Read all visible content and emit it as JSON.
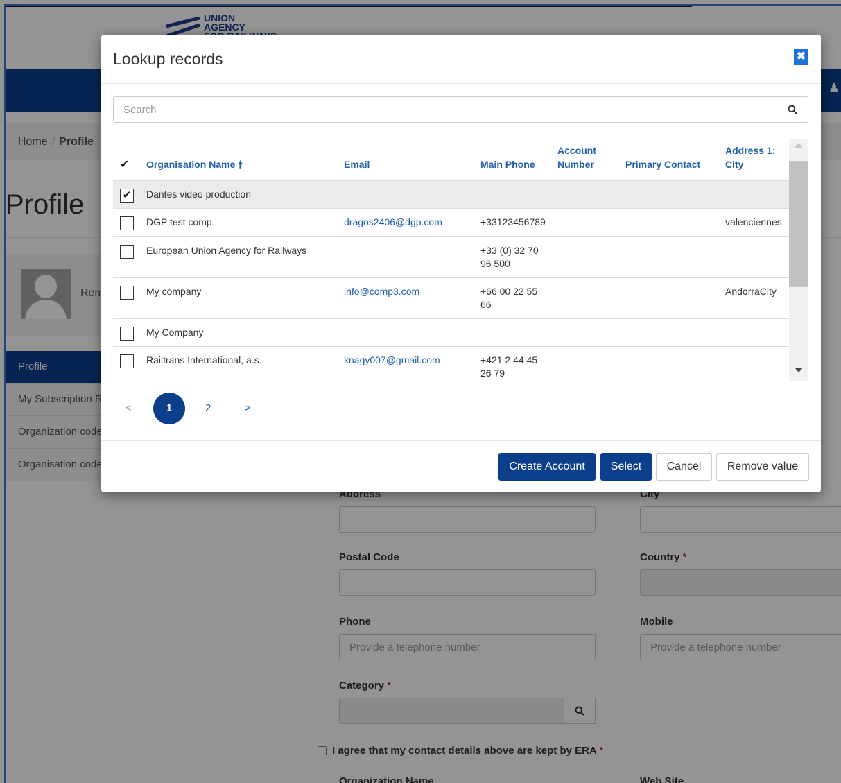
{
  "logo": {
    "line1": "UNION",
    "line2": "AGENCY",
    "line3": "FOR RAILWAYS"
  },
  "breadcrumb": {
    "home": "Home",
    "separator": "/",
    "current": "Profile"
  },
  "page": {
    "title": "Profile",
    "avatar_name": "Remi"
  },
  "side_nav": [
    {
      "label": "Profile",
      "active": true
    },
    {
      "label": "My Subscription Requests",
      "active": false
    },
    {
      "label": "Organization codes",
      "active": false
    },
    {
      "label": "Organisation codes",
      "active": false
    }
  ],
  "form": {
    "address_label": "Address",
    "city_label": "City",
    "postal_code_label": "Postal Code",
    "country_label": "Country",
    "phone_label": "Phone",
    "phone_placeholder": "Provide a telephone number",
    "mobile_label": "Mobile",
    "mobile_placeholder": "Provide a telephone number",
    "category_label": "Category",
    "required_mark": "*",
    "agree_text": "I agree that my contact details above are kept by ERA",
    "org_name_label": "Organization Name",
    "website_label": "Web Site"
  },
  "modal": {
    "title": "Lookup records",
    "close_icon": "close-icon",
    "search_placeholder": "Search",
    "columns": {
      "check": "✔",
      "org_name": "Organisation Name",
      "sort_arrow": "🠙",
      "email": "Email",
      "main_phone": "Main Phone",
      "account_number_line1": "Account",
      "account_number_line2": "Number",
      "primary_contact": "Primary Contact",
      "city_line1": "Address 1:",
      "city_line2": "City"
    },
    "rows": [
      {
        "checked": true,
        "name": "Dantes video production",
        "email": "",
        "phone1": "",
        "phone2": "",
        "account": "",
        "contact": "",
        "city": ""
      },
      {
        "checked": false,
        "name": "DGP test comp",
        "email": "dragos2406@dgp.com",
        "phone1": "+33123456789",
        "phone2": "",
        "account": "",
        "contact": "",
        "city": "valenciennes"
      },
      {
        "checked": false,
        "name": "European Union Agency for Railways",
        "email": "",
        "phone1": "+33 (0) 32 70",
        "phone2": "96 500",
        "account": "",
        "contact": "",
        "city": ""
      },
      {
        "checked": false,
        "name": "My company",
        "email": "info@comp3.com",
        "phone1": "+66 00 22 55",
        "phone2": "66",
        "account": "",
        "contact": "",
        "city": "AndorraCity"
      },
      {
        "checked": false,
        "name": "My Company",
        "email": "",
        "phone1": "",
        "phone2": "",
        "account": "",
        "contact": "",
        "city": ""
      },
      {
        "checked": false,
        "name": "Railtrans International, a.s.",
        "email": "knagy007@gmail.com",
        "phone1": "+421 2 44 45",
        "phone2": "26 79",
        "account": "",
        "contact": "",
        "city": ""
      }
    ],
    "pager": {
      "prev": "<",
      "current": "1",
      "page2": "2",
      "next": ">"
    },
    "buttons": {
      "create_account": "Create Account",
      "select": "Select",
      "cancel": "Cancel",
      "remove_value": "Remove value"
    }
  },
  "colors": {
    "brand_blue": "#0b3f8c",
    "link_blue": "#1f5fa8",
    "close_blue": "#1d72d8"
  }
}
